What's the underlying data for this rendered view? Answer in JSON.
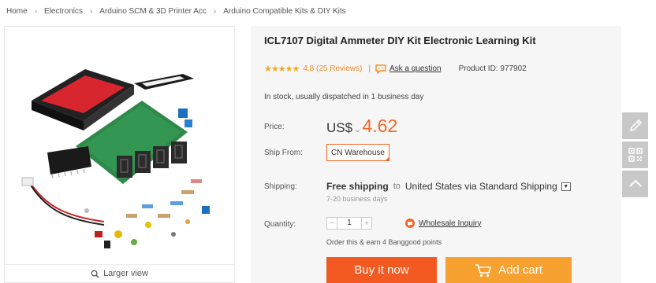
{
  "breadcrumb": {
    "items": [
      "Home",
      "Electronics",
      "Arduino SCM & 3D Printer Acc",
      "Arduino Compatible Kits & DIY Kits"
    ],
    "separator": "›"
  },
  "gallery": {
    "larger_view_label": "Larger view"
  },
  "product": {
    "title": "ICL7107 Digital Ammeter DIY Kit Electronic Learning Kit",
    "stars": "★★★★★",
    "rating_text": "4.8 (25 Reviews)",
    "ask_question": "Ask a question",
    "product_id": "Product ID: 977902",
    "stock": "In stock, usually dispatched in 1 business day"
  },
  "labels": {
    "price": "Price:",
    "ship_from": "Ship From:",
    "shipping": "Shipping:",
    "quantity": "Quantity:"
  },
  "price": {
    "currency": "US$",
    "currency_arrow": "⌄",
    "amount": "4.62"
  },
  "ship_from": {
    "selected": "CN Warehouse"
  },
  "shipping": {
    "free": "Free shipping",
    "to": "to",
    "destination": "United States via Standard Shipping",
    "days": "7-20 business days"
  },
  "quantity": {
    "minus": "−",
    "value": "1",
    "plus": "+"
  },
  "wholesale": {
    "label": "Wholesale Inquiry"
  },
  "points": {
    "text": "Order this & earn 4 Banggood points"
  },
  "buttons": {
    "buy_now": "Buy it now",
    "add_cart": "Add cart"
  },
  "colors": {
    "accent_orange": "#f26522",
    "cart_orange": "#f7a230",
    "star_color": "#f5a623",
    "side_tool_grey": "#c8c8c8"
  },
  "icons": {
    "side_tools": [
      "edit-icon",
      "qr-code-icon",
      "chevron-up-icon"
    ]
  }
}
